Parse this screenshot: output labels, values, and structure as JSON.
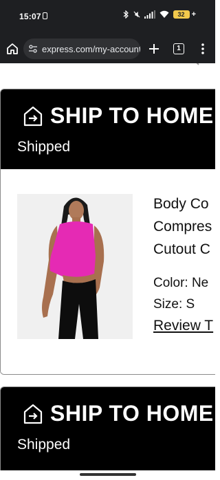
{
  "status_bar": {
    "time": "15:07",
    "battery": "32",
    "icons": [
      "sim-icon",
      "bluetooth-icon",
      "mute-icon",
      "signal-icon",
      "wifi-icon",
      "battery-icon"
    ]
  },
  "browser": {
    "url": "express.com/my-account/",
    "tab_count": "1",
    "icons": [
      "home-icon",
      "site-settings-icon",
      "plus-icon",
      "tabs-icon",
      "more-icon"
    ]
  },
  "orders": [
    {
      "title": "SHIP TO HOME",
      "status": "Shipped",
      "product": {
        "name": "Body Co\nCompres\nCutout C",
        "color": "Color: Ne",
        "size": "Size: S",
        "review": "Review T"
      }
    },
    {
      "title": "SHIP TO HOME",
      "status": "Shipped"
    }
  ],
  "colors": {
    "header_bg": "#000000",
    "chrome_bg": "#1e1f22",
    "product_color": "#e52ab4"
  }
}
